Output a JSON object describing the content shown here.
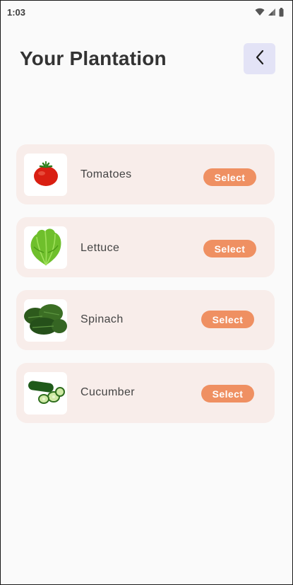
{
  "status_bar": {
    "time": "1:03",
    "icons": [
      "wifi-icon",
      "cell-signal-icon",
      "battery-icon"
    ]
  },
  "header": {
    "title": "Your Plantation",
    "back_icon": "chevron-left-icon"
  },
  "plants": [
    {
      "name": "Tomatoes",
      "action": "Select",
      "image": "tomato"
    },
    {
      "name": "Lettuce",
      "action": "Select",
      "image": "lettuce"
    },
    {
      "name": "Spinach",
      "action": "Select",
      "image": "spinach"
    },
    {
      "name": "Cucumber",
      "action": "Select",
      "image": "cucumber"
    }
  ],
  "colors": {
    "background": "#fafafa",
    "card": "#f8edea",
    "select_button": "#ef9062",
    "back_button": "#e3e3f6",
    "title": "#333333"
  }
}
